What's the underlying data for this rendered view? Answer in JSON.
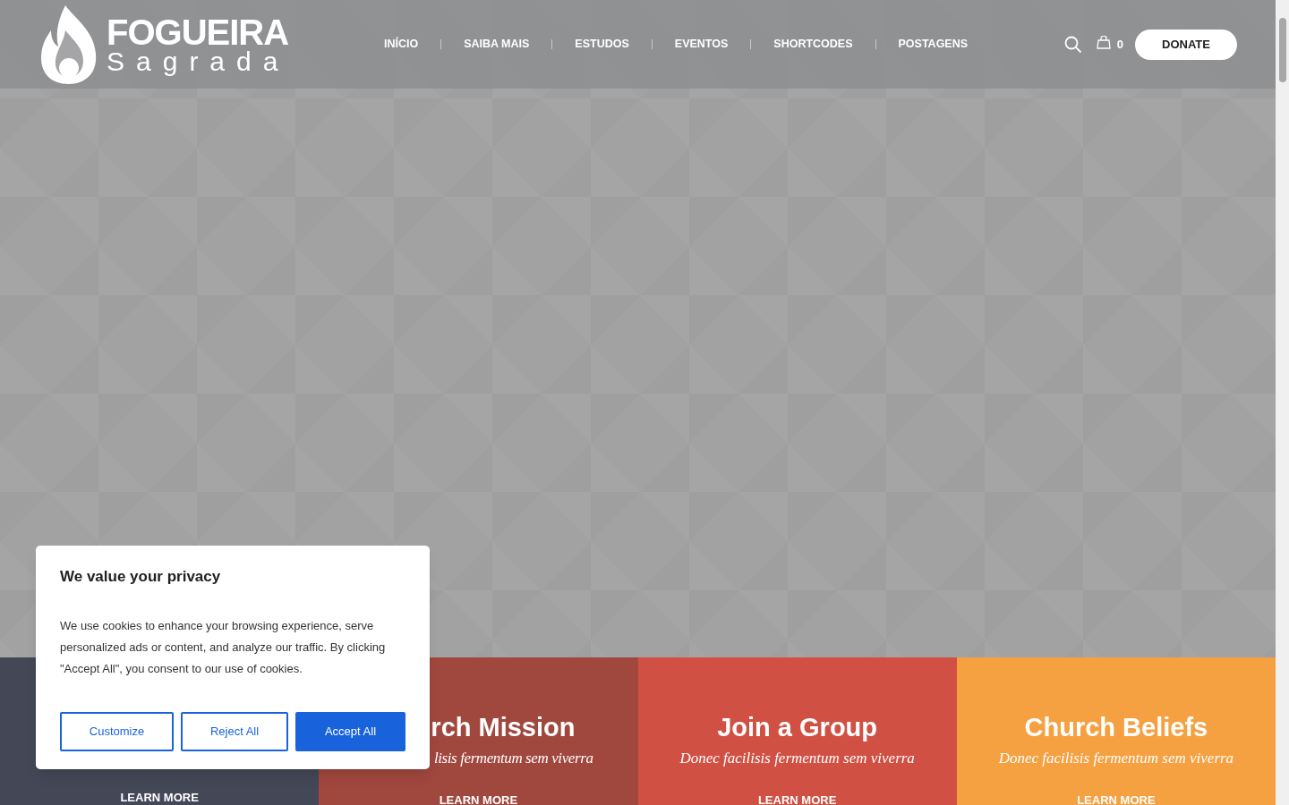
{
  "logo": {
    "title": "FOGUEIRA",
    "subtitle": "Sagrada"
  },
  "nav": [
    {
      "label": "INÍCIO"
    },
    {
      "label": "SAIBA MAIS"
    },
    {
      "label": "ESTUDOS"
    },
    {
      "label": "EVENTOS"
    },
    {
      "label": "SHORTCODES"
    },
    {
      "label": "POSTAGENS"
    }
  ],
  "cart_count": "0",
  "donate_button": "DONATE",
  "cards": [
    {
      "kind": "covered",
      "color": "#444756",
      "link": "LEARN MORE"
    },
    {
      "kind": "covered",
      "color": "#a0473e",
      "title": "rch Mission",
      "subtitle": "lisis fermentum sem viverra",
      "link": "LEARN MORE"
    },
    {
      "kind": "full",
      "color": "#d05043",
      "title": "Join a Group",
      "subtitle": "Donec facilisis fermentum sem viverra",
      "link": "LEARN MORE"
    },
    {
      "kind": "full",
      "color": "#f5a142",
      "title": "Church Beliefs",
      "subtitle": "Donec facilisis fermentum sem viverra",
      "link": "LEARN MORE"
    }
  ],
  "cookie_dialog": {
    "title": "We value your privacy",
    "text": "We use cookies to enhance your browsing experience, serve personalized ads or content, and analyze our traffic. By clicking \"Accept All\", you consent to our use of cookies.",
    "buttons": [
      {
        "label": "Customize",
        "kind": "outline"
      },
      {
        "label": "Reject All",
        "kind": "outline"
      },
      {
        "label": "Accept All",
        "kind": "primary"
      }
    ]
  }
}
